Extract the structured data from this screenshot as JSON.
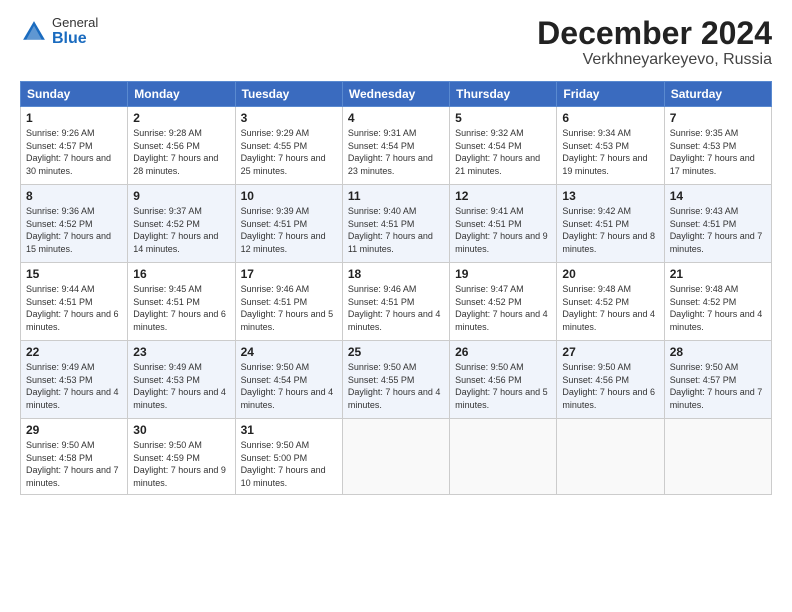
{
  "header": {
    "logo_general": "General",
    "logo_blue": "Blue",
    "month": "December 2024",
    "location": "Verkhneyarkeyevo, Russia"
  },
  "days_of_week": [
    "Sunday",
    "Monday",
    "Tuesday",
    "Wednesday",
    "Thursday",
    "Friday",
    "Saturday"
  ],
  "weeks": [
    [
      {
        "day": "1",
        "sunrise": "Sunrise: 9:26 AM",
        "sunset": "Sunset: 4:57 PM",
        "daylight": "Daylight: 7 hours and 30 minutes."
      },
      {
        "day": "2",
        "sunrise": "Sunrise: 9:28 AM",
        "sunset": "Sunset: 4:56 PM",
        "daylight": "Daylight: 7 hours and 28 minutes."
      },
      {
        "day": "3",
        "sunrise": "Sunrise: 9:29 AM",
        "sunset": "Sunset: 4:55 PM",
        "daylight": "Daylight: 7 hours and 25 minutes."
      },
      {
        "day": "4",
        "sunrise": "Sunrise: 9:31 AM",
        "sunset": "Sunset: 4:54 PM",
        "daylight": "Daylight: 7 hours and 23 minutes."
      },
      {
        "day": "5",
        "sunrise": "Sunrise: 9:32 AM",
        "sunset": "Sunset: 4:54 PM",
        "daylight": "Daylight: 7 hours and 21 minutes."
      },
      {
        "day": "6",
        "sunrise": "Sunrise: 9:34 AM",
        "sunset": "Sunset: 4:53 PM",
        "daylight": "Daylight: 7 hours and 19 minutes."
      },
      {
        "day": "7",
        "sunrise": "Sunrise: 9:35 AM",
        "sunset": "Sunset: 4:53 PM",
        "daylight": "Daylight: 7 hours and 17 minutes."
      }
    ],
    [
      {
        "day": "8",
        "sunrise": "Sunrise: 9:36 AM",
        "sunset": "Sunset: 4:52 PM",
        "daylight": "Daylight: 7 hours and 15 minutes."
      },
      {
        "day": "9",
        "sunrise": "Sunrise: 9:37 AM",
        "sunset": "Sunset: 4:52 PM",
        "daylight": "Daylight: 7 hours and 14 minutes."
      },
      {
        "day": "10",
        "sunrise": "Sunrise: 9:39 AM",
        "sunset": "Sunset: 4:51 PM",
        "daylight": "Daylight: 7 hours and 12 minutes."
      },
      {
        "day": "11",
        "sunrise": "Sunrise: 9:40 AM",
        "sunset": "Sunset: 4:51 PM",
        "daylight": "Daylight: 7 hours and 11 minutes."
      },
      {
        "day": "12",
        "sunrise": "Sunrise: 9:41 AM",
        "sunset": "Sunset: 4:51 PM",
        "daylight": "Daylight: 7 hours and 9 minutes."
      },
      {
        "day": "13",
        "sunrise": "Sunrise: 9:42 AM",
        "sunset": "Sunset: 4:51 PM",
        "daylight": "Daylight: 7 hours and 8 minutes."
      },
      {
        "day": "14",
        "sunrise": "Sunrise: 9:43 AM",
        "sunset": "Sunset: 4:51 PM",
        "daylight": "Daylight: 7 hours and 7 minutes."
      }
    ],
    [
      {
        "day": "15",
        "sunrise": "Sunrise: 9:44 AM",
        "sunset": "Sunset: 4:51 PM",
        "daylight": "Daylight: 7 hours and 6 minutes."
      },
      {
        "day": "16",
        "sunrise": "Sunrise: 9:45 AM",
        "sunset": "Sunset: 4:51 PM",
        "daylight": "Daylight: 7 hours and 6 minutes."
      },
      {
        "day": "17",
        "sunrise": "Sunrise: 9:46 AM",
        "sunset": "Sunset: 4:51 PM",
        "daylight": "Daylight: 7 hours and 5 minutes."
      },
      {
        "day": "18",
        "sunrise": "Sunrise: 9:46 AM",
        "sunset": "Sunset: 4:51 PM",
        "daylight": "Daylight: 7 hours and 4 minutes."
      },
      {
        "day": "19",
        "sunrise": "Sunrise: 9:47 AM",
        "sunset": "Sunset: 4:52 PM",
        "daylight": "Daylight: 7 hours and 4 minutes."
      },
      {
        "day": "20",
        "sunrise": "Sunrise: 9:48 AM",
        "sunset": "Sunset: 4:52 PM",
        "daylight": "Daylight: 7 hours and 4 minutes."
      },
      {
        "day": "21",
        "sunrise": "Sunrise: 9:48 AM",
        "sunset": "Sunset: 4:52 PM",
        "daylight": "Daylight: 7 hours and 4 minutes."
      }
    ],
    [
      {
        "day": "22",
        "sunrise": "Sunrise: 9:49 AM",
        "sunset": "Sunset: 4:53 PM",
        "daylight": "Daylight: 7 hours and 4 minutes."
      },
      {
        "day": "23",
        "sunrise": "Sunrise: 9:49 AM",
        "sunset": "Sunset: 4:53 PM",
        "daylight": "Daylight: 7 hours and 4 minutes."
      },
      {
        "day": "24",
        "sunrise": "Sunrise: 9:50 AM",
        "sunset": "Sunset: 4:54 PM",
        "daylight": "Daylight: 7 hours and 4 minutes."
      },
      {
        "day": "25",
        "sunrise": "Sunrise: 9:50 AM",
        "sunset": "Sunset: 4:55 PM",
        "daylight": "Daylight: 7 hours and 4 minutes."
      },
      {
        "day": "26",
        "sunrise": "Sunrise: 9:50 AM",
        "sunset": "Sunset: 4:56 PM",
        "daylight": "Daylight: 7 hours and 5 minutes."
      },
      {
        "day": "27",
        "sunrise": "Sunrise: 9:50 AM",
        "sunset": "Sunset: 4:56 PM",
        "daylight": "Daylight: 7 hours and 6 minutes."
      },
      {
        "day": "28",
        "sunrise": "Sunrise: 9:50 AM",
        "sunset": "Sunset: 4:57 PM",
        "daylight": "Daylight: 7 hours and 7 minutes."
      }
    ],
    [
      {
        "day": "29",
        "sunrise": "Sunrise: 9:50 AM",
        "sunset": "Sunset: 4:58 PM",
        "daylight": "Daylight: 7 hours and 7 minutes."
      },
      {
        "day": "30",
        "sunrise": "Sunrise: 9:50 AM",
        "sunset": "Sunset: 4:59 PM",
        "daylight": "Daylight: 7 hours and 9 minutes."
      },
      {
        "day": "31",
        "sunrise": "Sunrise: 9:50 AM",
        "sunset": "Sunset: 5:00 PM",
        "daylight": "Daylight: 7 hours and 10 minutes."
      },
      null,
      null,
      null,
      null
    ]
  ]
}
